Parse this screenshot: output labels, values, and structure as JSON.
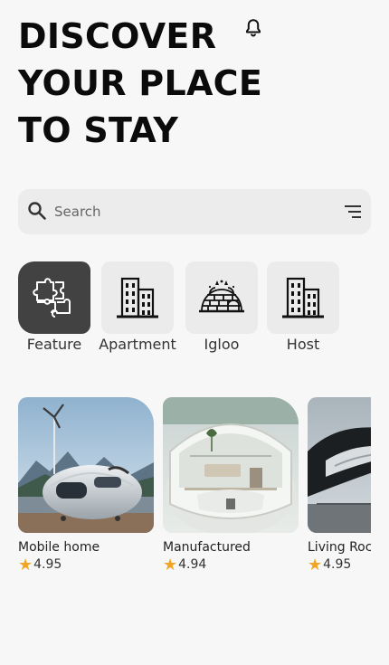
{
  "header": {
    "title_lines": [
      "DISCOVER",
      "YOUR PLACE",
      "TO STAY"
    ],
    "notification_icon": "bell-icon"
  },
  "search": {
    "placeholder": "Search",
    "value": "",
    "icon": "search-icon",
    "filter_icon": "filter-lines-icon"
  },
  "categories": [
    {
      "label": "Feature",
      "icon": "puzzle-icon",
      "selected": true
    },
    {
      "label": "Apartment",
      "icon": "building-icon",
      "selected": false
    },
    {
      "label": "Igloo",
      "icon": "igloo-icon",
      "selected": false
    },
    {
      "label": "Host",
      "icon": "building-icon",
      "selected": false
    }
  ],
  "listings": [
    {
      "name": "Mobile home",
      "rating": "4.95"
    },
    {
      "name": "Manufactured",
      "rating": "4.94"
    },
    {
      "name": "Living Rocket",
      "rating": "4.95"
    }
  ],
  "colors": {
    "background": "#f7f7f8",
    "active_tile": "#424242",
    "tile": "#ebebec",
    "star": "#f0a623"
  }
}
